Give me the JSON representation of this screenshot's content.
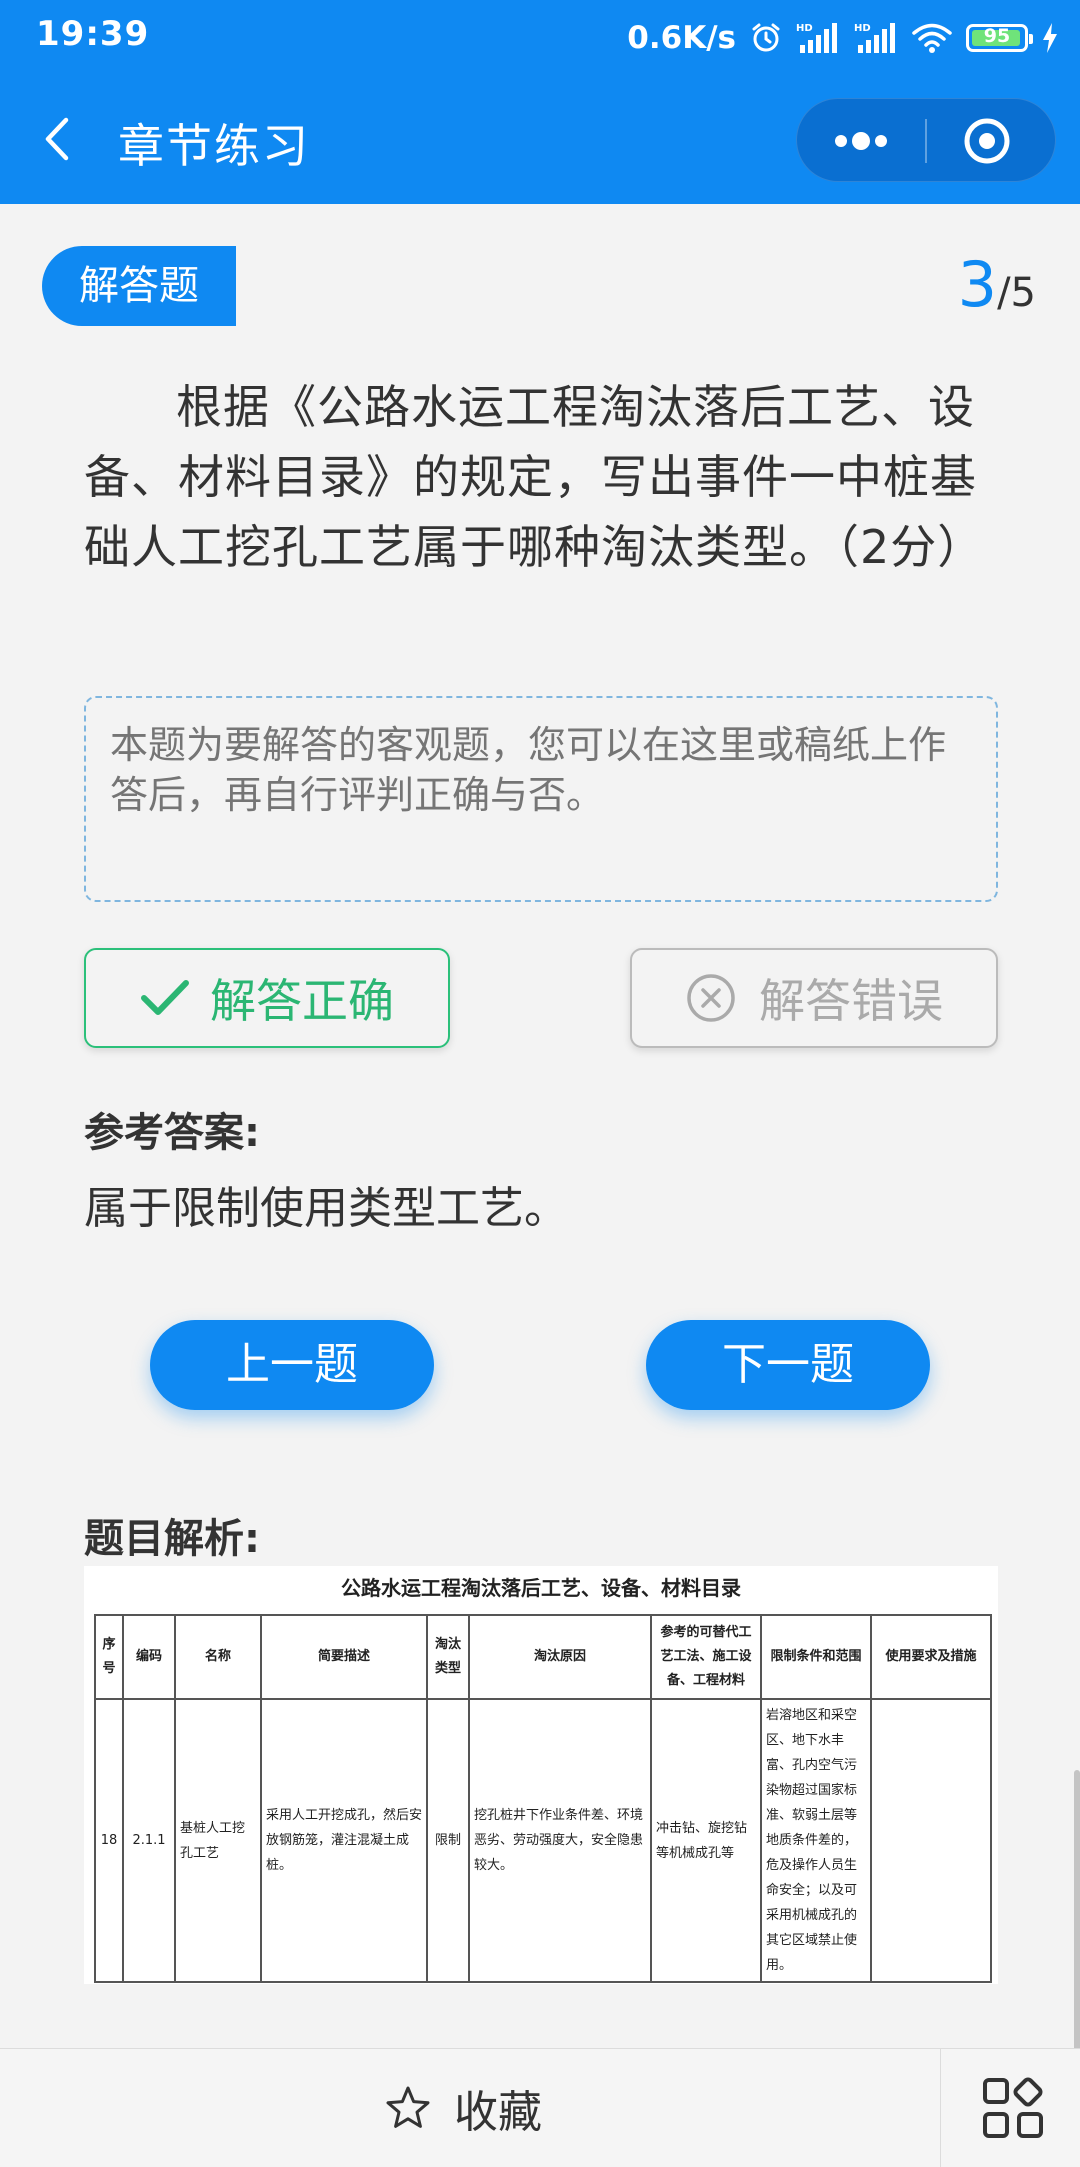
{
  "status_bar": {
    "time": "19:39",
    "speed": "0.6K/s",
    "battery": "95",
    "battery_level": 0.95,
    "icons": [
      "alarm-icon",
      "signal-hd-icon",
      "signal-hd-icon",
      "wifi-icon",
      "battery-icon",
      "charging-icon"
    ]
  },
  "nav": {
    "title": "章节练习",
    "back_icon": "chevron-left-icon",
    "more_icon": "more-dots-icon",
    "close_icon": "target-close-icon"
  },
  "question": {
    "type": "解答题",
    "current": "3",
    "total": "/5",
    "text": "根据《公路水运工程淘汰落后工艺、设备、材料目录》的规定，写出事件一中桩基础人工挖孔工艺属于哪种淘汰类型。（2分）",
    "answer_placeholder": "本题为要解答的客观题，您可以在这里或稿纸上作答后，再自行评判正确与否。"
  },
  "judge": {
    "correct_label": "解答正确",
    "wrong_label": "解答错误"
  },
  "reference": {
    "title": "参考答案:",
    "text": "属于限制使用类型工艺。"
  },
  "navigation": {
    "prev_label": "上一题",
    "next_label": "下一题"
  },
  "analysis": {
    "title": "题目解析:",
    "image": {
      "title": "公路水运工程淘汰落后工艺、设备、材料目录",
      "headers": [
        "序号",
        "编码",
        "名称",
        "简要描述",
        "淘汰类型",
        "淘汰原因",
        "参考的可替代工艺工法、施工设备、工程材料",
        "限制条件和范围",
        "使用要求及措施"
      ],
      "row": [
        "18",
        "2.1.1",
        "基桩人工挖孔工艺",
        "采用人工开挖成孔，然后安放钢筋笼，灌注混凝土成桩。",
        "限制",
        "挖孔桩井下作业条件差、环境恶劣、劳动强度大，安全隐患较大。",
        "冲击钻、旋挖钻等机械成孔等",
        "岩溶地区和采空区、地下水丰富、孔内空气污染物超过国家标准、软弱土层等地质条件差的，危及操作人员生命安全；以及可采用机械成孔的其它区域禁止使用。",
        ""
      ]
    }
  },
  "bottom_bar": {
    "favorite_label": "收藏",
    "favorite_icon": "star-outline-icon",
    "grid_icon": "grid-icon"
  },
  "colors": {
    "primary": "#0f89f2",
    "success": "#2bb673",
    "muted": "#aaaaaa"
  }
}
